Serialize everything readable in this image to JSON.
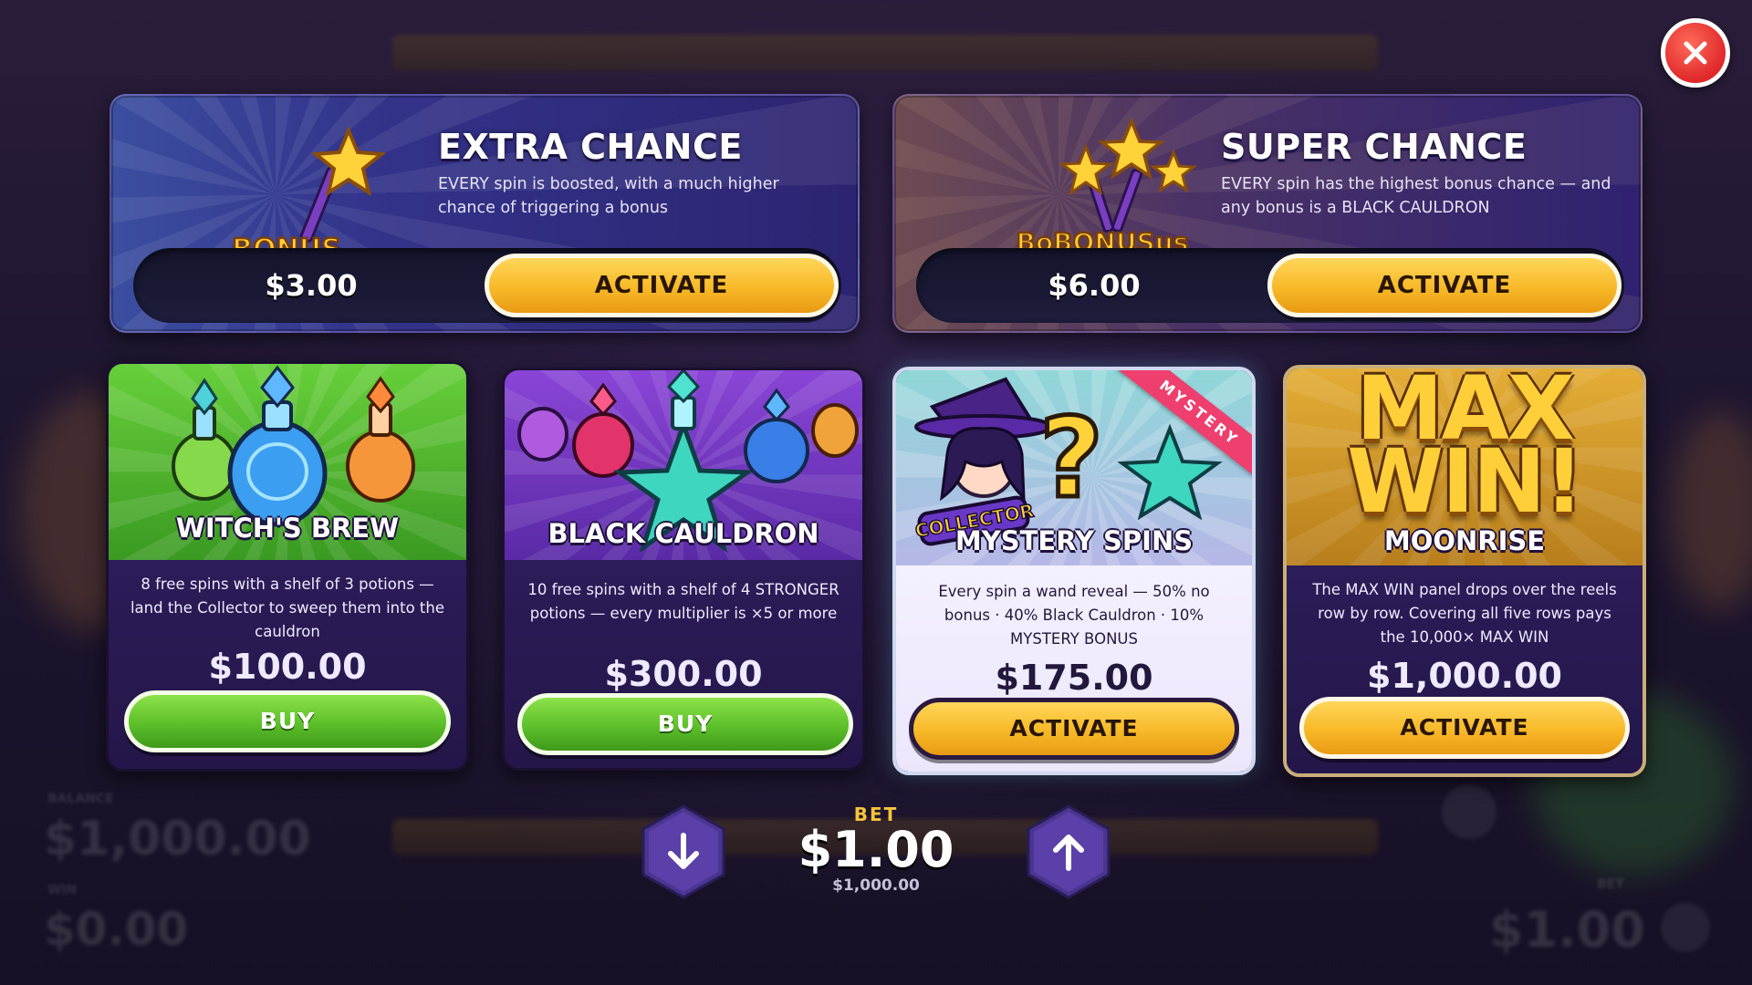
{
  "background": {
    "balance_label": "BALANCE",
    "balance_value": "$1,000.00",
    "win_label": "WIN",
    "win_value": "$0.00",
    "bet_label": "BET",
    "bet_value": "$1.00"
  },
  "boosts": [
    {
      "title": "EXTRA CHANCE",
      "description": "EVERY spin is boosted, with a much higher chance of triggering a bonus",
      "art_text": "BONUS",
      "price": "$3.00",
      "button": "ACTIVATE"
    },
    {
      "title": "SUPER CHANCE",
      "description": "EVERY spin has the highest bonus chance — and any bonus is a BLACK CAULDRON",
      "art_text": "BoBONUSus",
      "price": "$6.00",
      "button": "ACTIVATE"
    }
  ],
  "cards": [
    {
      "title": "WITCH'S BREW",
      "description": "8 free spins with a shelf of 3 potions — land the Collector to sweep them into the cauldron",
      "price": "$100.00",
      "button": "BUY"
    },
    {
      "title": "BLACK CAULDRON",
      "description": "10 free spins with a shelf of 4 STRONGER potions — every multiplier is ×5 or more",
      "price": "$300.00",
      "button": "BUY"
    },
    {
      "title": "MYSTERY SPINS",
      "ribbon": "MYSTERY",
      "art_text": "COLLECTOR",
      "description": "Every spin a wand reveal — 50% no bonus · 40% Black Cauldron · 10% MYSTERY BONUS",
      "price": "$175.00",
      "button": "ACTIVATE"
    },
    {
      "title": "MOONRISE",
      "art_line1": "MAX",
      "art_line2": "WIN!",
      "description": "The MAX WIN panel drops over the reels row by row. Covering all five rows pays the 10,000× MAX WIN",
      "price": "$1,000.00",
      "button": "ACTIVATE"
    }
  ],
  "bet": {
    "label": "BET",
    "value": "$1.00",
    "balance": "$1,000.00"
  },
  "icons": {
    "close": "close-icon",
    "decrease": "arrow-down-icon",
    "increase": "arrow-up-icon"
  },
  "colors": {
    "gold_button": "#f7b928",
    "green_button": "#5cbf2a",
    "close_red": "#e0282a",
    "bet_label": "#f6c33a",
    "ribbon": "#ee3f6e"
  }
}
